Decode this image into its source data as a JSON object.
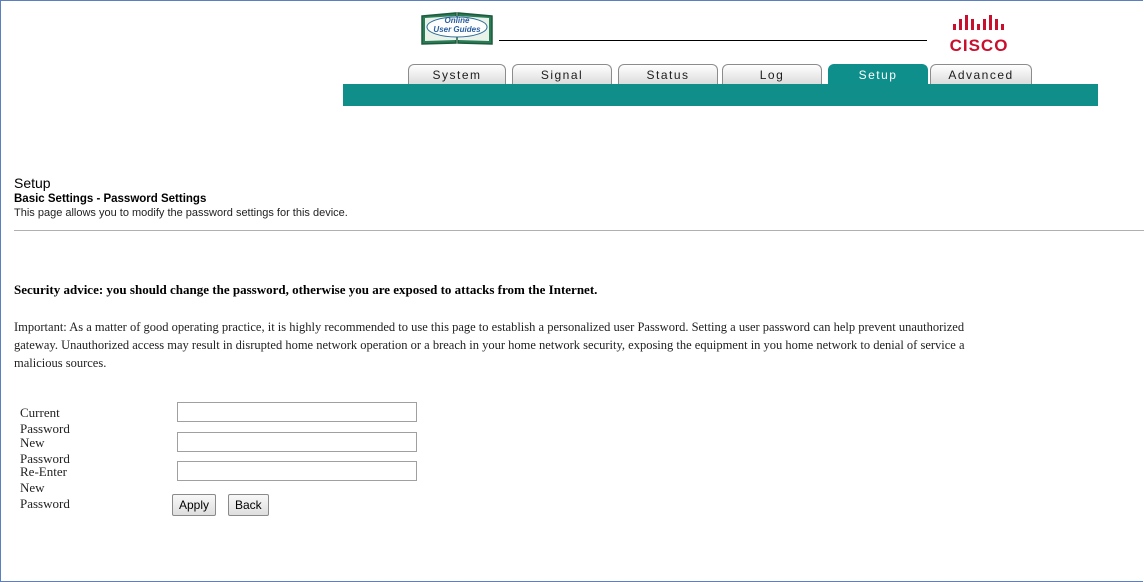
{
  "header": {
    "logo_text": [
      "Online",
      "User Guides"
    ],
    "brand": "CISCO",
    "colors": {
      "teal": "#108e89",
      "cisco_red": "#c8102e"
    }
  },
  "tabs": [
    {
      "label": "System"
    },
    {
      "label": "Signal"
    },
    {
      "label": "Status"
    },
    {
      "label": "Log"
    },
    {
      "label": "Setup",
      "active": true
    },
    {
      "label": "Advanced"
    }
  ],
  "page": {
    "title": "Setup",
    "subtitle": "Basic Settings - Password Settings",
    "description": "This page allows you to modify the password settings for this device.",
    "security_advice": "Security advice: you should change the password, otherwise you are exposed to attacks from the Internet.",
    "important_lines": [
      "Important: As a matter of good operating practice, it is highly recommended to use this page to establish a personalized user Password. Setting a user password can help prevent unauthorized",
      "gateway. Unauthorized access may result in disrupted home network operation or a breach in your home network security, exposing the equipment in you home network to denial of service a",
      "malicious sources."
    ]
  },
  "form": {
    "current_label": "Current Password",
    "current_value": "",
    "new_label": "New Password",
    "new_value": "",
    "reenter_label": "Re-Enter New Password",
    "reenter_value": "",
    "apply_label": "Apply",
    "back_label": "Back"
  }
}
